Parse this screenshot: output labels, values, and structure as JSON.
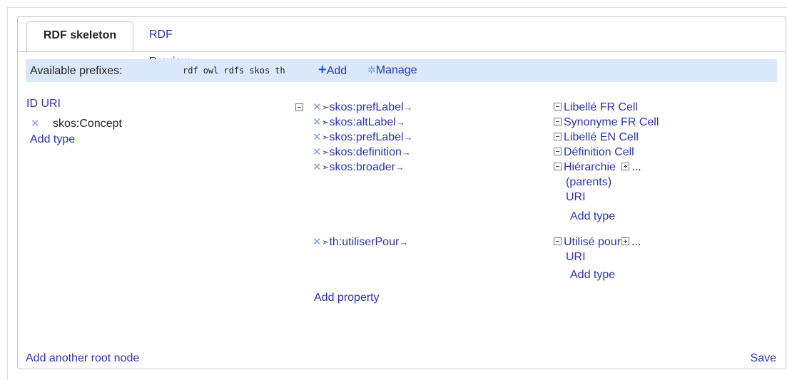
{
  "tabs": [
    {
      "label": "RDF skeleton",
      "active": true
    },
    {
      "label": "RDF Preview",
      "active": false
    }
  ],
  "prefixes": {
    "label": "Available prefixes:",
    "items": [
      "rdf",
      "owl",
      "rdfs",
      "skos",
      "th"
    ],
    "add_label": "Add",
    "manage_label": "Manage"
  },
  "root": {
    "subject": "ID URI",
    "type": "skos:Concept",
    "add_type": "Add type"
  },
  "properties": [
    {
      "name": "skos:prefLabel",
      "target": "Libellé FR Cell"
    },
    {
      "name": "skos:altLabel",
      "target": "Synonyme FR Cell"
    },
    {
      "name": "skos:prefLabel",
      "target": "Libellé EN Cell"
    },
    {
      "name": "skos:definition",
      "target": "Définition Cell"
    },
    {
      "name": "skos:broader",
      "target_line1": "Hiérarchie",
      "target_line2": "(parents)",
      "target_uri": "URI",
      "ellipsis": "...",
      "add_type": "Add type"
    },
    {
      "name": "th:utiliserPour",
      "target_line1": "Utilisé pour",
      "target_uri": "URI",
      "ellipsis": "...",
      "add_type": "Add type"
    }
  ],
  "add_property": "Add property",
  "footer": {
    "add_root": "Add another root node",
    "save": "Save"
  },
  "colors": {
    "link": "#2a33b8",
    "prefix_bar": "#dbe8fa",
    "remove_icon": "#7f9fd6"
  }
}
